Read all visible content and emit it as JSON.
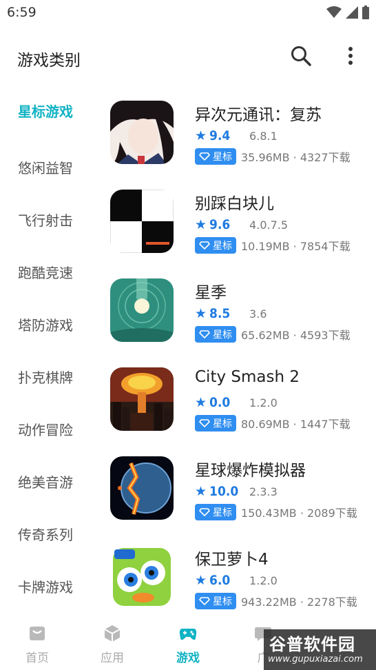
{
  "status_bar": {
    "time": "6:59"
  },
  "header": {
    "title": "游戏类别"
  },
  "sidebar": {
    "items": [
      {
        "label": "星标游戏",
        "active": true
      },
      {
        "label": "悠闲益智"
      },
      {
        "label": "飞行射击"
      },
      {
        "label": "跑酷竞速"
      },
      {
        "label": "塔防游戏"
      },
      {
        "label": "扑克棋牌"
      },
      {
        "label": "动作冒险"
      },
      {
        "label": "绝美音游"
      },
      {
        "label": "传奇系列"
      },
      {
        "label": "卡牌游戏"
      }
    ]
  },
  "games": [
    {
      "name": "异次元通讯：复苏",
      "score": "9.4",
      "version": "6.8.1",
      "badge": "星标",
      "meta": "35.96MB · 4327下载"
    },
    {
      "name": "别踩白块儿",
      "score": "9.6",
      "version": "4.0.7.5",
      "badge": "星标",
      "meta": "10.19MB · 7854下载"
    },
    {
      "name": "星季",
      "score": "8.5",
      "version": "3.6",
      "badge": "星标",
      "meta": "65.62MB · 4593下载"
    },
    {
      "name": "City Smash 2",
      "score": "0.0",
      "version": "1.2.0",
      "badge": "星标",
      "meta": "80.69MB · 1447下载"
    },
    {
      "name": "星球爆炸模拟器",
      "score": "10.0",
      "version": "2.3.3",
      "badge": "星标",
      "meta": "150.43MB · 2089下载"
    },
    {
      "name": "保卫萝卜4",
      "score": "6.0",
      "version": "1.2.0",
      "badge": "星标",
      "meta": "943.22MB · 2278下载"
    }
  ],
  "bottom_nav": {
    "items": [
      {
        "label": "首页",
        "icon": "home-icon"
      },
      {
        "label": "应用",
        "icon": "cube-icon"
      },
      {
        "label": "游戏",
        "icon": "gamepad-icon",
        "active": true
      },
      {
        "label": "广",
        "icon": "chat-icon"
      }
    ]
  },
  "watermark": {
    "main": "谷普软件园",
    "sub": "www.gupuxiazai.com"
  },
  "colors": {
    "accent": "#11b3c4",
    "rating": "#1f7be0",
    "badge": "#2f8ef0"
  }
}
